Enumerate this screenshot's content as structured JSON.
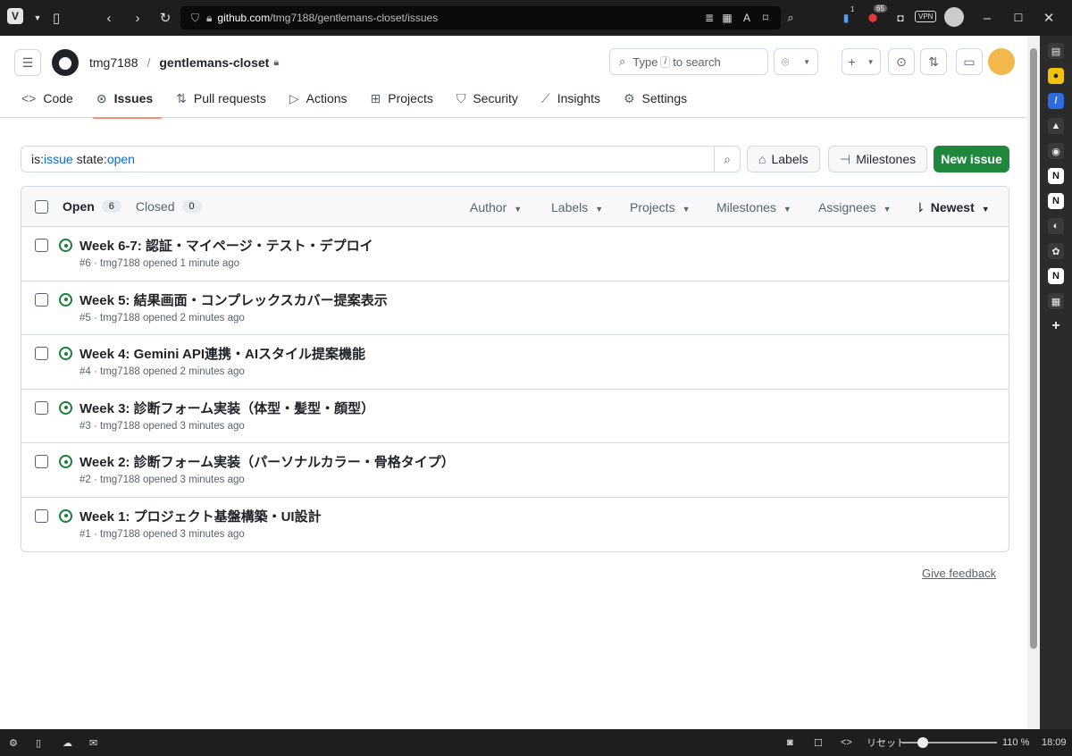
{
  "browser": {
    "url_host": "github.com",
    "url_path": "/tmg7188/gentlemans-closet/issues",
    "badge_1": "1",
    "badge_65": "65",
    "vpn_label": "VPN"
  },
  "header": {
    "owner": "tmg7188",
    "repo": "gentlemans-closet",
    "search_prefix": "Type",
    "search_key": "/",
    "search_suffix": "to search"
  },
  "tabs": [
    {
      "label": "Code",
      "icon": "code-icon"
    },
    {
      "label": "Issues",
      "icon": "issue-opened-icon"
    },
    {
      "label": "Pull requests",
      "icon": "git-pull-request-icon"
    },
    {
      "label": "Actions",
      "icon": "play-icon"
    },
    {
      "label": "Projects",
      "icon": "table-icon"
    },
    {
      "label": "Security",
      "icon": "shield-icon"
    },
    {
      "label": "Insights",
      "icon": "graph-icon"
    },
    {
      "label": "Settings",
      "icon": "gear-icon"
    }
  ],
  "filter": {
    "is_label": "is:",
    "is_value": "issue",
    "state_label": " state:",
    "state_value": "open",
    "labels_btn": "Labels",
    "milestones_btn": "Milestones",
    "new_issue_btn": "New issue"
  },
  "list_header": {
    "open_label": "Open",
    "open_count": "6",
    "closed_label": "Closed",
    "closed_count": "0",
    "filters": [
      "Author",
      "Labels",
      "Projects",
      "Milestones",
      "Assignees"
    ],
    "sort_label": "Newest"
  },
  "issues": [
    {
      "title": "Week 6-7: 認証・マイページ・テスト・デプロイ",
      "meta": "#6 · tmg7188 opened 1 minute ago"
    },
    {
      "title": "Week 5: 結果画面・コンプレックスカバー提案表示",
      "meta": "#5 · tmg7188 opened 2 minutes ago"
    },
    {
      "title": "Week 4: Gemini API連携・AIスタイル提案機能",
      "meta": "#4 · tmg7188 opened 2 minutes ago"
    },
    {
      "title": "Week 3: 診断フォーム実装（体型・髪型・顔型）",
      "meta": "#3 · tmg7188 opened 3 minutes ago"
    },
    {
      "title": "Week 2: 診断フォーム実装（パーソナルカラー・骨格タイプ）",
      "meta": "#2 · tmg7188 opened 3 minutes ago"
    },
    {
      "title": "Week 1: プロジェクト基盤構築・UI設計",
      "meta": "#1 · tmg7188 opened 3 minutes ago"
    }
  ],
  "footer": {
    "feedback": "Give feedback"
  },
  "status_bar": {
    "reset_label": "リセット",
    "zoom": "110 %",
    "clock": "18:09"
  },
  "colors": {
    "accent_green": "#1f883d",
    "open_icon": "#1a7f37",
    "tab_underline": "#fd8c73",
    "link_blue": "#0969da"
  }
}
